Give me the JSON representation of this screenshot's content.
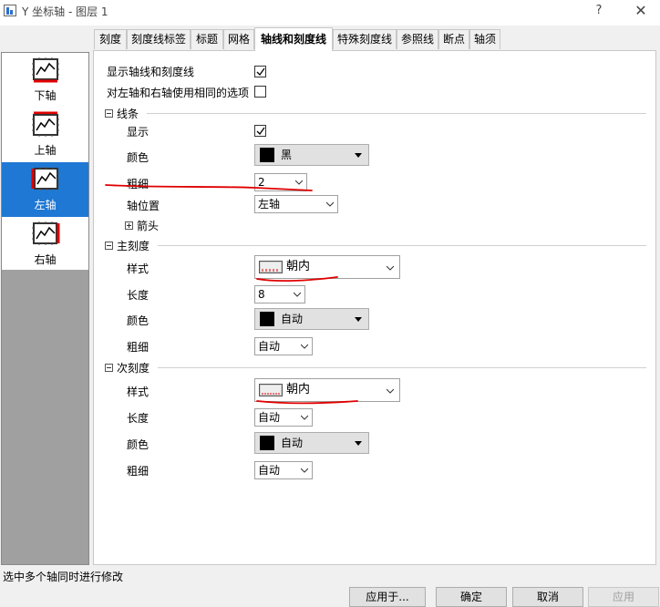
{
  "window": {
    "title": "Y 坐标轴 - 图层 1",
    "help_glyph": "?",
    "close_glyph": "✕"
  },
  "tabs": [
    {
      "label": "刻度"
    },
    {
      "label": "刻度线标签"
    },
    {
      "label": "标题"
    },
    {
      "label": "网格"
    },
    {
      "label": "轴线和刻度线",
      "active": true
    },
    {
      "label": "特殊刻度线"
    },
    {
      "label": "参照线"
    },
    {
      "label": "断点"
    },
    {
      "label": "轴须"
    }
  ],
  "axes": [
    {
      "label": "下轴",
      "selected": false
    },
    {
      "label": "上轴",
      "selected": false
    },
    {
      "label": "左轴",
      "selected": true
    },
    {
      "label": "右轴",
      "selected": false
    }
  ],
  "options": {
    "show_axis_label": "显示轴线和刻度线",
    "show_axis_checked": true,
    "same_options_label": "对左轴和右轴使用相同的选项",
    "same_options_checked": false
  },
  "line": {
    "header": "线条",
    "show_label": "显示",
    "show_checked": true,
    "color_label": "颜色",
    "color_value": "黑",
    "color_swatch": "#000000",
    "thickness_label": "粗细",
    "thickness_value": "2",
    "position_label": "轴位置",
    "position_value": "左轴",
    "arrow_label": "箭头"
  },
  "major": {
    "header": "主刻度",
    "style_label": "样式",
    "style_value": "朝内",
    "length_label": "长度",
    "length_value": "8",
    "color_label": "颜色",
    "color_value": "自动",
    "color_swatch": "#000000",
    "thickness_label": "粗细",
    "thickness_value": "自动"
  },
  "minor": {
    "header": "次刻度",
    "style_label": "样式",
    "style_value": "朝内",
    "length_label": "长度",
    "length_value": "自动",
    "color_label": "颜色",
    "color_value": "自动",
    "color_swatch": "#000000",
    "thickness_label": "粗细",
    "thickness_value": "自动"
  },
  "status_text": "选中多个轴同时进行修改",
  "buttons": {
    "apply_to": "应用于...",
    "ok": "确定",
    "cancel": "取消",
    "apply": "应用"
  },
  "colors": {
    "selection": "#1e78d4",
    "annotation_ink": "#e00000"
  }
}
